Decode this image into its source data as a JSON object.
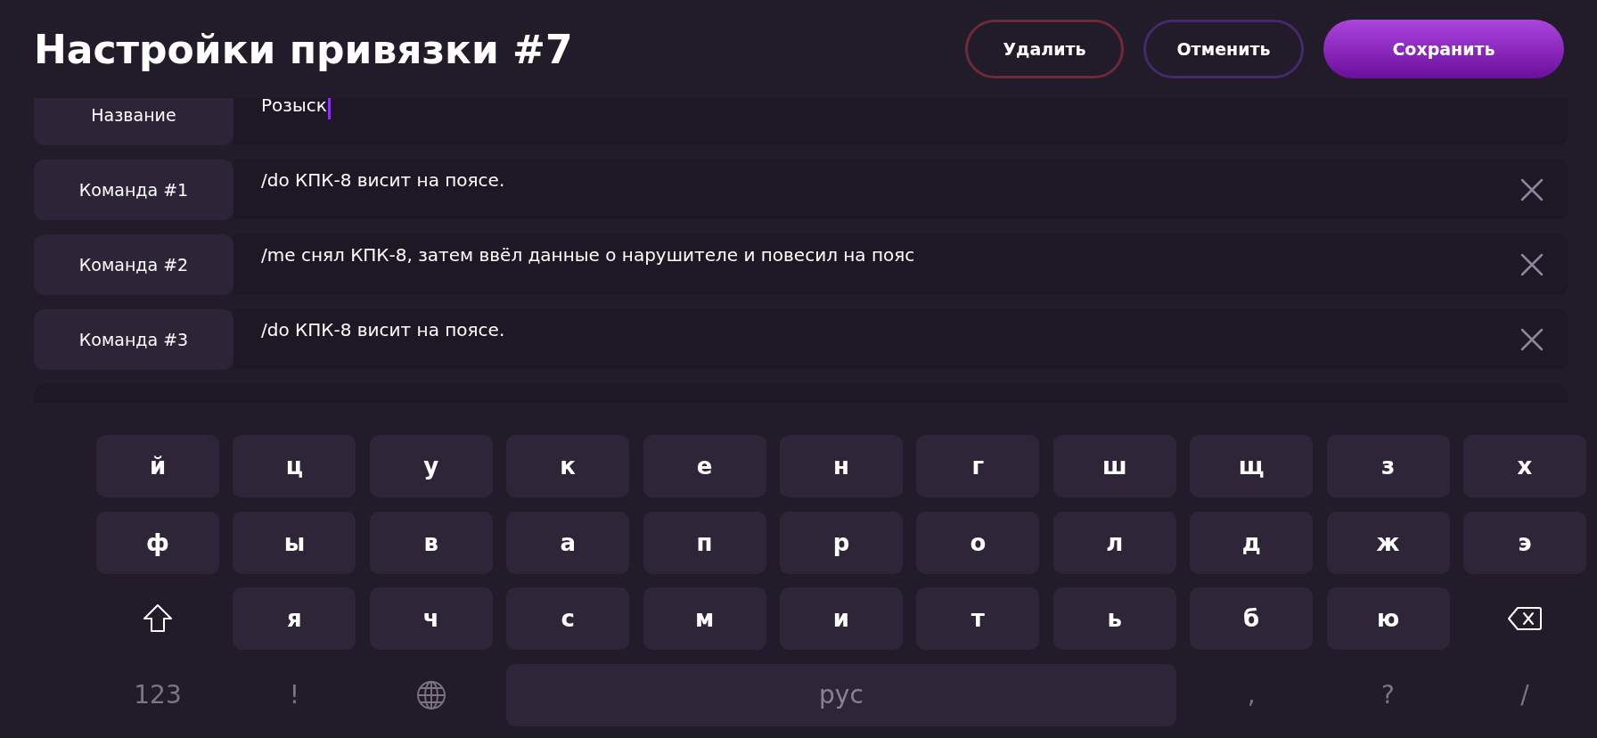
{
  "title": "Настройки привязки #7",
  "buttons": [
    {
      "label": "Удалить",
      "kind": "danger"
    },
    {
      "label": "Отменить",
      "kind": "outline"
    },
    {
      "label": "Сохранить",
      "kind": "primary"
    }
  ],
  "name_field": {
    "label": "Название",
    "value": "Розыск",
    "focused": true
  },
  "commands": [
    {
      "label": "Команда #1",
      "value": "/do КПК-8 висит на поясе."
    },
    {
      "label": "Команда #2",
      "value": "/me снял КПК-8, затем ввёл данные о нарушителе и повесил на пояс"
    },
    {
      "label": "Команда #3",
      "value": "/do КПК-8 висит на поясе."
    }
  ],
  "keyboard": [
    [
      {
        "kind": "letter",
        "label": "й"
      },
      {
        "kind": "letter",
        "label": "ц"
      },
      {
        "kind": "letter",
        "label": "у"
      },
      {
        "kind": "letter",
        "label": "к"
      },
      {
        "kind": "letter",
        "label": "е"
      },
      {
        "kind": "letter",
        "label": "н"
      },
      {
        "kind": "letter",
        "label": "г"
      },
      {
        "kind": "letter",
        "label": "ш"
      },
      {
        "kind": "letter",
        "label": "щ"
      },
      {
        "kind": "letter",
        "label": "з"
      },
      {
        "kind": "letter",
        "label": "х"
      }
    ],
    [
      {
        "kind": "letter",
        "label": "ф"
      },
      {
        "kind": "letter",
        "label": "ы"
      },
      {
        "kind": "letter",
        "label": "в"
      },
      {
        "kind": "letter",
        "label": "а"
      },
      {
        "kind": "letter",
        "label": "п"
      },
      {
        "kind": "letter",
        "label": "р"
      },
      {
        "kind": "letter",
        "label": "о"
      },
      {
        "kind": "letter",
        "label": "л"
      },
      {
        "kind": "letter",
        "label": "д"
      },
      {
        "kind": "letter",
        "label": "ж"
      },
      {
        "kind": "letter",
        "label": "э"
      }
    ],
    [
      {
        "kind": "shift"
      },
      {
        "kind": "letter",
        "label": "я"
      },
      {
        "kind": "letter",
        "label": "ч"
      },
      {
        "kind": "letter",
        "label": "с"
      },
      {
        "kind": "letter",
        "label": "м"
      },
      {
        "kind": "letter",
        "label": "и"
      },
      {
        "kind": "letter",
        "label": "т"
      },
      {
        "kind": "letter",
        "label": "ь"
      },
      {
        "kind": "letter",
        "label": "б"
      },
      {
        "kind": "letter",
        "label": "ю"
      },
      {
        "kind": "backspace"
      }
    ],
    [
      {
        "kind": "plain",
        "label": "123"
      },
      {
        "kind": "plain",
        "label": "!"
      },
      {
        "kind": "globe"
      },
      {
        "kind": "space",
        "label": "рус"
      },
      {
        "kind": "plain",
        "label": ","
      },
      {
        "kind": "plain",
        "label": "?"
      },
      {
        "kind": "plain",
        "label": "/"
      }
    ]
  ]
}
